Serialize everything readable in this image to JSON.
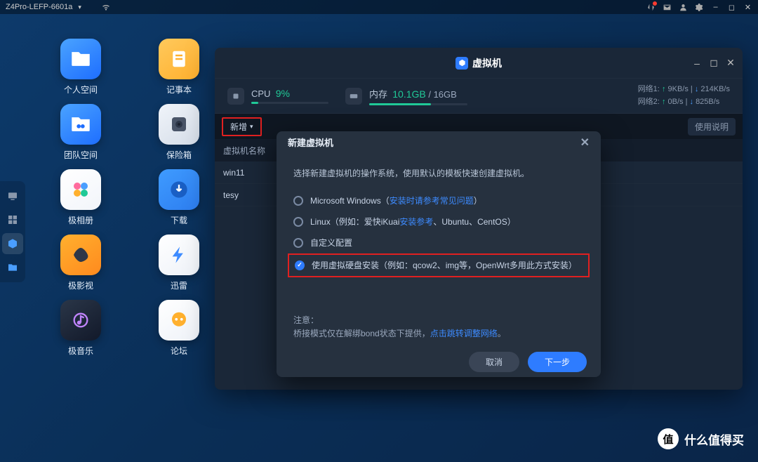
{
  "topbar": {
    "hostname": "Z4Pro-LEFP-6601a"
  },
  "desktop_icons": [
    {
      "label": "个人空间",
      "bg": "linear-gradient(145deg,#4aa3ff,#1e6eff)",
      "glyph": "folder"
    },
    {
      "label": "记事本",
      "bg": "linear-gradient(145deg,#ffc95c,#ffb02e)",
      "glyph": "note"
    },
    {
      "label": "团队空间",
      "bg": "linear-gradient(145deg,#4aa3ff,#1e6eff)",
      "glyph": "folder-team"
    },
    {
      "label": "保险箱",
      "bg": "linear-gradient(145deg,#f0f4fa,#d5dde8)",
      "glyph": "vault"
    },
    {
      "label": "极相册",
      "bg": "linear-gradient(145deg,#ffffff,#f2f5fa)",
      "glyph": "album"
    },
    {
      "label": "下载",
      "bg": "linear-gradient(145deg,#3f9bff,#2d7ef0)",
      "glyph": "download"
    },
    {
      "label": "极影视",
      "bg": "linear-gradient(145deg,#ffb02e,#ff8a1e)",
      "glyph": "media"
    },
    {
      "label": "迅雷",
      "bg": "linear-gradient(145deg,#ffffff,#eef2f8)",
      "glyph": "xunlei"
    },
    {
      "label": "极音乐",
      "bg": "linear-gradient(145deg,#2a3648,#12192a)",
      "glyph": "music"
    },
    {
      "label": "论坛",
      "bg": "linear-gradient(145deg,#ffffff,#eef2f8)",
      "glyph": "forum"
    }
  ],
  "vm_window": {
    "title": "虚拟机",
    "cpu_label": "CPU",
    "cpu_value": "9%",
    "cpu_pct": 9,
    "mem_label": "内存",
    "mem_used": "10.1GB",
    "mem_sep": " / ",
    "mem_total": "16GB",
    "mem_pct": 63,
    "net1_label": "网络1:",
    "net1_up": "9KB/s",
    "net1_dn": "214KB/s",
    "net2_label": "网络2:",
    "net2_up": "0B/s",
    "net2_dn": "825B/s",
    "add_btn": "新增",
    "help_btn": "使用说明",
    "col_name": "虚拟机名称",
    "rows": [
      "win11",
      "tesy"
    ]
  },
  "modal": {
    "title": "新建虚拟机",
    "hint": "选择新建虚拟机的操作系统，使用默认的模板快速创建虚拟机。",
    "opt1_label": "Microsoft Windows（",
    "opt1_link": "安装时请参考常见问题",
    "opt1_tail": "）",
    "opt2_label": "Linux（例如：爱快iKuai",
    "opt2_link": "安装参考",
    "opt2_tail": "、Ubuntu、CentOS）",
    "opt3_label": "自定义配置",
    "opt4_label": "使用虚拟硬盘安装（例如：qcow2、img等，OpenWrt多用此方式安装）",
    "note_title": "注意：",
    "note_body": "桥接模式仅在解绑bond状态下提供，",
    "note_link": "点击跳转调整网络",
    "note_tail": "。",
    "cancel": "取消",
    "next": "下一步"
  },
  "watermark": {
    "badge": "值",
    "text": "什么值得买"
  }
}
